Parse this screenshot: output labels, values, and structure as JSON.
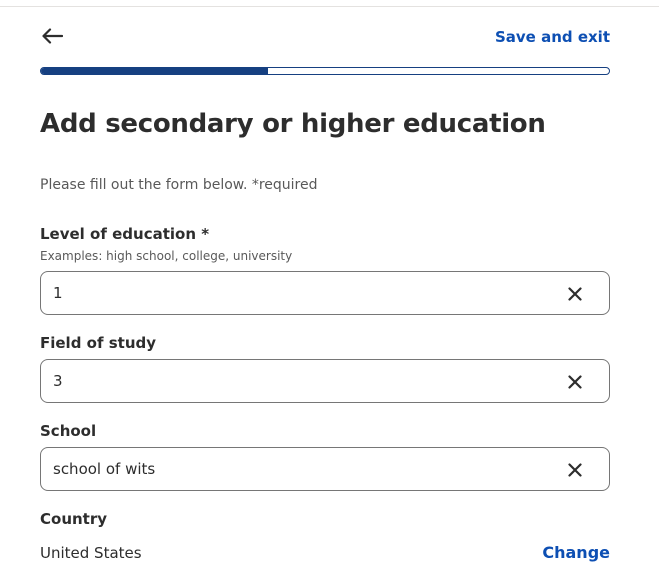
{
  "header": {
    "back_icon": "arrow-left-icon",
    "save_exit_label": "Save and exit"
  },
  "progress": {
    "fraction": 0.4
  },
  "page": {
    "title": "Add secondary or higher education",
    "subtitle": "Please fill out the form below. *required"
  },
  "fields": {
    "education_level": {
      "label": "Level of education *",
      "hint": "Examples: high school, college, university",
      "value": "1",
      "clear_icon": "close-icon"
    },
    "field_of_study": {
      "label": "Field of study",
      "value": "3",
      "clear_icon": "close-icon"
    },
    "school": {
      "label": "School",
      "value": "school of wits",
      "clear_icon": "close-icon"
    },
    "country": {
      "label": "Country",
      "value": "United States",
      "change_label": "Change"
    }
  },
  "colors": {
    "accent": "#0d4fb3",
    "progress": "#164081",
    "text": "#2d2d2d",
    "muted": "#595959",
    "border": "#767676"
  }
}
